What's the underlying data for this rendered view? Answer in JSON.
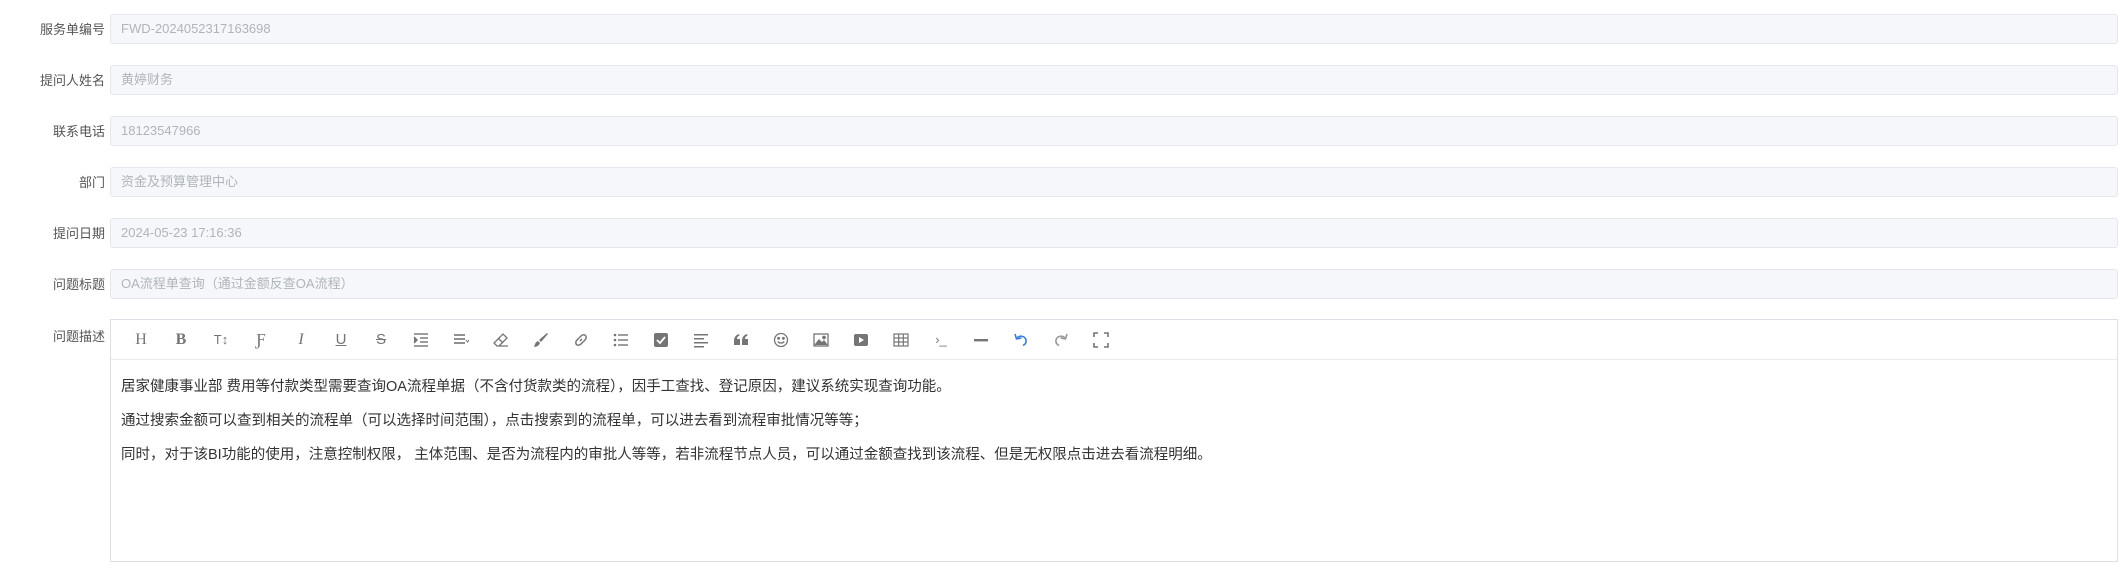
{
  "form": {
    "fields": [
      {
        "label": "服务单编号",
        "value": "FWD-2024052317163698"
      },
      {
        "label": "提问人姓名",
        "value": "黄婷财务"
      },
      {
        "label": "联系电话",
        "value": "18123547966"
      },
      {
        "label": "部门",
        "value": "资金及预算管理中心"
      },
      {
        "label": "提问日期",
        "value": "2024-05-23 17:16:36"
      },
      {
        "label": "问题标题",
        "value": "OA流程单查询（通过金额反查OA流程）"
      }
    ],
    "description_label": "问题描述",
    "description_lines": [
      "居家健康事业部 费用等付款类型需要查询OA流程单据（不含付货款类的流程），因手工查找、登记原因，建议系统实现查询功能。",
      "通过搜索金额可以查到相关的流程单（可以选择时间范围），点击搜索到的流程单，可以进去看到流程审批情况等等；",
      "同时，对于该BI功能的使用，注意控制权限， 主体范围、是否为流程内的审批人等等，若非流程节点人员，可以通过金额查找到该流程、但是无权限点击进去看流程明细。"
    ]
  },
  "toolbar": {
    "heading": "H",
    "bold": "B",
    "text_size": "T↕",
    "font": "Ƒ",
    "italic": "I",
    "underline": "U",
    "strike": "S",
    "code_inline": "›_"
  },
  "colors": {
    "accent": "#3b7fd8",
    "input_bg": "#f5f7fa",
    "input_text": "#b0b4bb"
  }
}
